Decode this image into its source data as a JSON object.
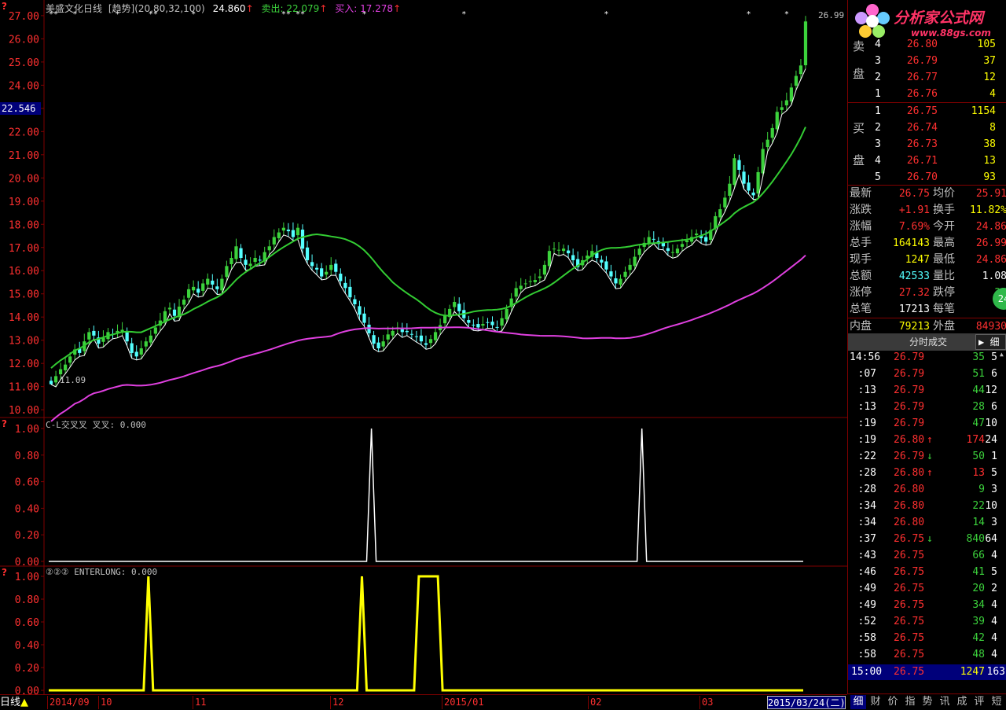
{
  "header": {
    "title": "美盛文化日线",
    "indicator": "[趋势]",
    "params": "(20,80,32,100)",
    "val": "24.860",
    "sell_label": "卖出: 22.079",
    "buy_label": "买入: 17.278",
    "cursor_price": "22.546",
    "low_label": "11.09",
    "high_label": "26.99"
  },
  "sub1": {
    "title": "C-L交叉叉 叉叉: 0.000"
  },
  "sub2": {
    "title": "②②② ENTERLONG: 0.000"
  },
  "bottom": {
    "tab": "日线",
    "dates": [
      "2014/09",
      "10",
      "11",
      "12",
      "2015/01",
      "02",
      "03"
    ],
    "current_date": "2015/03/24(二)"
  },
  "logo": {
    "text": "分析家公式网",
    "url": "www.88gs.com"
  },
  "quote": {
    "sell": [
      {
        "idx": "4",
        "price": "26.80",
        "vol": "105"
      },
      {
        "idx": "3",
        "price": "26.79",
        "vol": "37"
      },
      {
        "idx": "2",
        "price": "26.77",
        "vol": "12"
      },
      {
        "idx": "1",
        "price": "26.76",
        "vol": "4"
      }
    ],
    "sell_label": [
      "卖",
      "盘"
    ],
    "buy": [
      {
        "idx": "1",
        "price": "26.75",
        "vol": "1154"
      },
      {
        "idx": "2",
        "price": "26.74",
        "vol": "8"
      },
      {
        "idx": "3",
        "price": "26.73",
        "vol": "38"
      },
      {
        "idx": "4",
        "price": "26.71",
        "vol": "13"
      },
      {
        "idx": "5",
        "price": "26.70",
        "vol": "93"
      }
    ],
    "buy_label": [
      "买",
      "盘"
    ],
    "stats": [
      {
        "l1": "最新",
        "v1": "26.75",
        "l2": "均价",
        "v2": "25.91"
      },
      {
        "l1": "涨跌",
        "v1": "+1.91",
        "l2": "换手",
        "v2": "11.82%"
      },
      {
        "l1": "涨幅",
        "v1": "7.69%",
        "l2": "今开",
        "v2": "24.86"
      },
      {
        "l1": "总手",
        "v1": "164143",
        "l2": "最高",
        "v2": "26.99"
      },
      {
        "l1": "现手",
        "v1": "1247",
        "l2": "最低",
        "v2": "24.86"
      },
      {
        "l1": "总额",
        "v1": "42533",
        "l2": "量比",
        "v2": "1.08"
      },
      {
        "l1": "涨停",
        "v1": "27.32",
        "l2": "跌停",
        "v2": "22"
      },
      {
        "l1": "总笔",
        "v1": "17213",
        "l2": "每笔",
        "v2": ""
      },
      {
        "l1": "内盘",
        "v1": "79213",
        "l2": "外盘",
        "v2": "84930"
      }
    ],
    "badge": "24",
    "tick_tab": "分时成交",
    "tick_tab2": "细",
    "ticks": [
      {
        "t": "14:56",
        "p": "26.79",
        "a": "",
        "v": "35",
        "n": "5"
      },
      {
        "t": ":07",
        "p": "26.79",
        "a": "",
        "v": "51",
        "n": "6"
      },
      {
        "t": ":13",
        "p": "26.79",
        "a": "",
        "v": "44",
        "n": "12"
      },
      {
        "t": ":13",
        "p": "26.79",
        "a": "",
        "v": "28",
        "n": "6"
      },
      {
        "t": ":19",
        "p": "26.79",
        "a": "",
        "v": "47",
        "n": "10"
      },
      {
        "t": ":19",
        "p": "26.80",
        "a": "↑",
        "v": "174",
        "n": "24"
      },
      {
        "t": ":22",
        "p": "26.79",
        "a": "↓",
        "v": "50",
        "n": "1"
      },
      {
        "t": ":28",
        "p": "26.80",
        "a": "↑",
        "v": "13",
        "n": "5"
      },
      {
        "t": ":28",
        "p": "26.80",
        "a": "",
        "v": "9",
        "n": "3"
      },
      {
        "t": ":34",
        "p": "26.80",
        "a": "",
        "v": "22",
        "n": "10"
      },
      {
        "t": ":34",
        "p": "26.80",
        "a": "",
        "v": "14",
        "n": "3"
      },
      {
        "t": ":37",
        "p": "26.75",
        "a": "↓",
        "v": "840",
        "n": "64"
      },
      {
        "t": ":43",
        "p": "26.75",
        "a": "",
        "v": "66",
        "n": "4"
      },
      {
        "t": ":46",
        "p": "26.75",
        "a": "",
        "v": "41",
        "n": "5"
      },
      {
        "t": ":49",
        "p": "26.75",
        "a": "",
        "v": "20",
        "n": "2"
      },
      {
        "t": ":49",
        "p": "26.75",
        "a": "",
        "v": "34",
        "n": "4"
      },
      {
        "t": ":52",
        "p": "26.75",
        "a": "",
        "v": "39",
        "n": "4"
      },
      {
        "t": ":58",
        "p": "26.75",
        "a": "",
        "v": "42",
        "n": "4"
      },
      {
        "t": ":58",
        "p": "26.75",
        "a": "",
        "v": "48",
        "n": "4"
      }
    ],
    "last_tick": {
      "t": "15:00",
      "p": "26.75",
      "v": "1247",
      "n": "163"
    },
    "bottom_tabs": [
      "细",
      "财",
      "价",
      "指",
      "势",
      "讯",
      "成",
      "评",
      "短"
    ]
  },
  "colors": {
    "up": "#ff3030",
    "down": "#54ffff",
    "green": "#3cd23c",
    "ma1": "#33cc33",
    "ma2": "#e040e0",
    "yellow": "#ffff00",
    "grid": "#800000"
  },
  "chart_data": [
    {
      "type": "candlestick",
      "title": "美盛文化日线",
      "ylim": [
        9.7,
        27.2
      ],
      "yticks": [
        10.0,
        11.0,
        12.0,
        13.0,
        14.0,
        15.0,
        16.0,
        17.0,
        18.0,
        19.0,
        20.0,
        21.0,
        22.0,
        23.0,
        24.0,
        25.0,
        26.0,
        27.0
      ],
      "x_labels": [
        "2014/09",
        "10",
        "11",
        "12",
        "2015/01",
        "02",
        "03"
      ],
      "closes": [
        11.1,
        11.45,
        11.75,
        11.95,
        12.3,
        12.6,
        12.45,
        12.95,
        13.35,
        13.2,
        12.85,
        13.1,
        13.35,
        13.25,
        13.4,
        13.45,
        12.95,
        12.45,
        12.3,
        12.65,
        12.95,
        13.2,
        13.55,
        13.85,
        14.25,
        14.4,
        14.05,
        14.45,
        14.75,
        15.2,
        15.3,
        15.05,
        15.45,
        15.65,
        15.4,
        15.2,
        15.65,
        16.2,
        16.55,
        17.05,
        16.55,
        16.25,
        16.3,
        16.55,
        16.45,
        16.8,
        17.05,
        17.45,
        17.65,
        17.85,
        17.7,
        17.45,
        17.85,
        16.95,
        16.45,
        16.2,
        16.05,
        15.75,
        15.95,
        16.25,
        15.95,
        15.55,
        15.25,
        14.85,
        14.55,
        14.1,
        13.75,
        13.3,
        12.85,
        12.65,
        12.95,
        13.25,
        13.4,
        13.55,
        13.35,
        13.35,
        13.25,
        13.15,
        12.95,
        12.8,
        13.05,
        13.35,
        13.65,
        14.05,
        14.35,
        14.65,
        14.25,
        13.95,
        13.75,
        13.65,
        13.55,
        13.7,
        13.75,
        13.65,
        13.55,
        13.95,
        14.35,
        14.8,
        15.25,
        15.35,
        15.45,
        15.55,
        15.6,
        15.75,
        16.25,
        16.85,
        16.95,
        16.9,
        16.95,
        16.75,
        16.45,
        16.15,
        16.45,
        16.65,
        16.85,
        16.55,
        16.35,
        16.05,
        15.75,
        15.45,
        15.65,
        15.95,
        16.25,
        16.6,
        16.95,
        17.2,
        17.45,
        17.35,
        17.15,
        17.05,
        16.85,
        16.8,
        16.95,
        17.15,
        17.3,
        17.45,
        17.6,
        17.4,
        17.25,
        17.75,
        18.35,
        18.65,
        19.15,
        19.75,
        20.85,
        20.35,
        19.75,
        19.45,
        19.25,
        20.25,
        21.25,
        21.65,
        22.15,
        22.85,
        23.05,
        23.35,
        23.9,
        24.4,
        24.85,
        26.75
      ]
    },
    {
      "type": "line",
      "title": "C-L交叉叉 叉叉: 0.000",
      "ylim": [
        0,
        1
      ],
      "yticks": [
        0.0,
        0.2,
        0.4,
        0.6,
        0.8,
        1.0
      ],
      "spikes": [
        68,
        125
      ],
      "n": 160
    },
    {
      "type": "line",
      "title": "②②② ENTERLONG: 0.000",
      "ylim": [
        0,
        1
      ],
      "yticks": [
        0.0,
        0.2,
        0.4,
        0.6,
        0.8,
        1.0
      ],
      "spikes": [
        21,
        66
      ],
      "plateau": [
        78,
        82
      ],
      "n": 160
    }
  ]
}
